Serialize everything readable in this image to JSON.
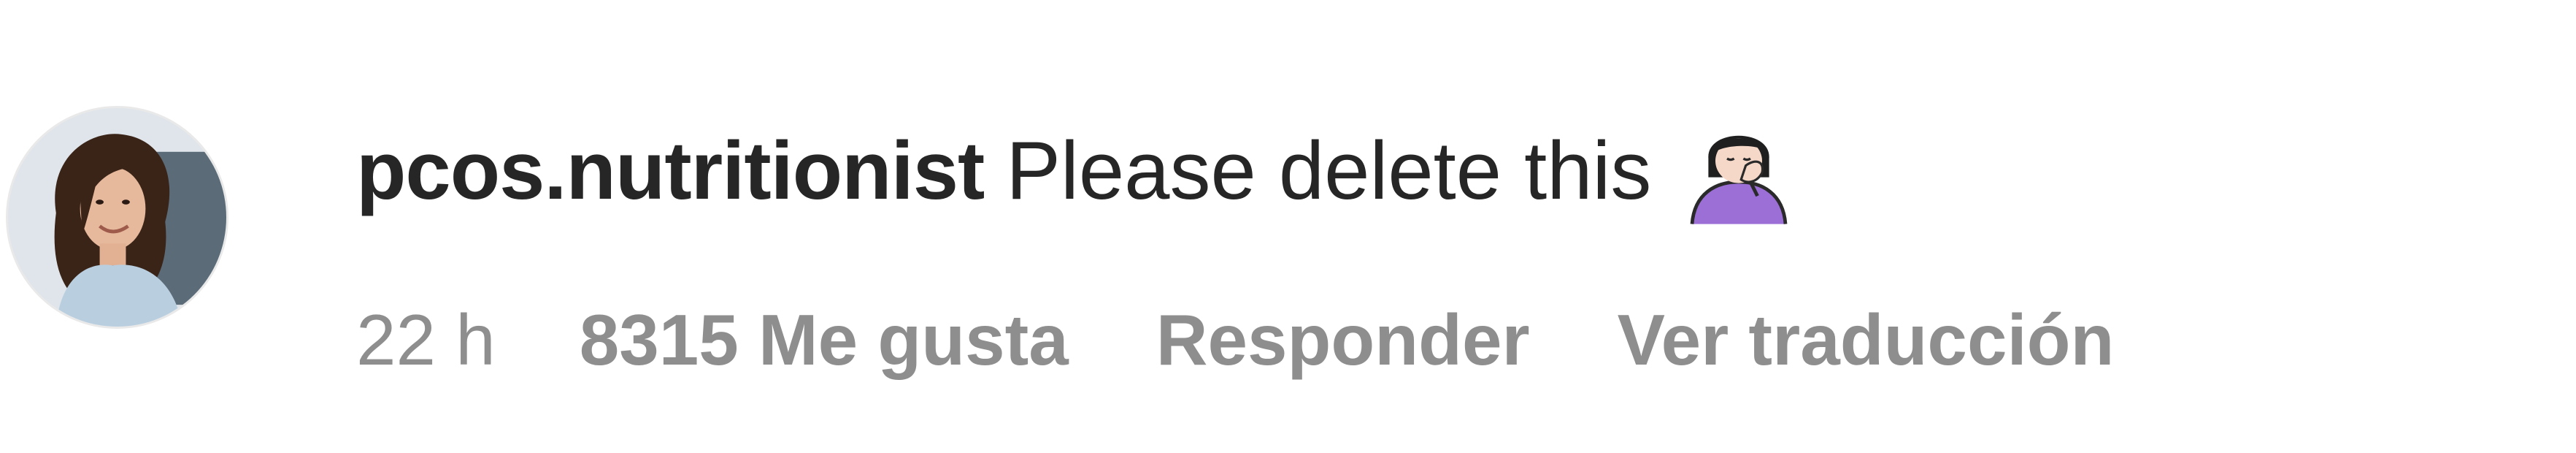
{
  "comment": {
    "avatar_icon": "profile-photo-woman",
    "username": "pcos.nutritionist",
    "text": "Please delete this",
    "emoji_icon": "person-facepalming-emoji",
    "time": "22 h",
    "likes_label": "8315 Me gusta",
    "reply_label": "Responder",
    "translate_label": "Ver traducción"
  },
  "colors": {
    "text_primary": "#262626",
    "text_secondary": "#8e8e8e",
    "background": "#ffffff",
    "emoji_purple": "#9b6fd6"
  }
}
